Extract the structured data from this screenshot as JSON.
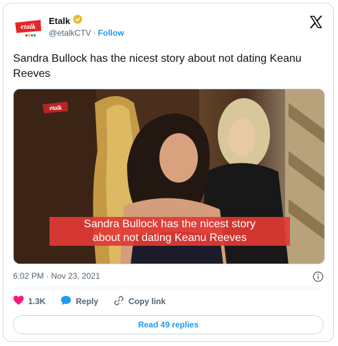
{
  "account": {
    "name": "Etalk",
    "handle": "@etalkCTV",
    "separator": "·",
    "follow_label": "Follow",
    "logo_text": "etalk"
  },
  "tweet": {
    "text": "Sandra Bullock has the nicest story about not dating Keanu Reeves",
    "timestamp": "6:02 PM · Nov 23, 2021"
  },
  "media": {
    "caption_line1": "Sandra Bullock has the nicest story",
    "caption_line2": "about not dating Keanu Reeves",
    "watermark_text": "etalk"
  },
  "actions": {
    "likes": "1.3K",
    "reply_label": "Reply",
    "copy_link_label": "Copy link"
  },
  "replies_button": "Read 49 replies",
  "colors": {
    "accent": "#1d9bf0",
    "like": "#f91880",
    "caption_bg": "#e23a34",
    "brand_red": "#e4262b"
  }
}
